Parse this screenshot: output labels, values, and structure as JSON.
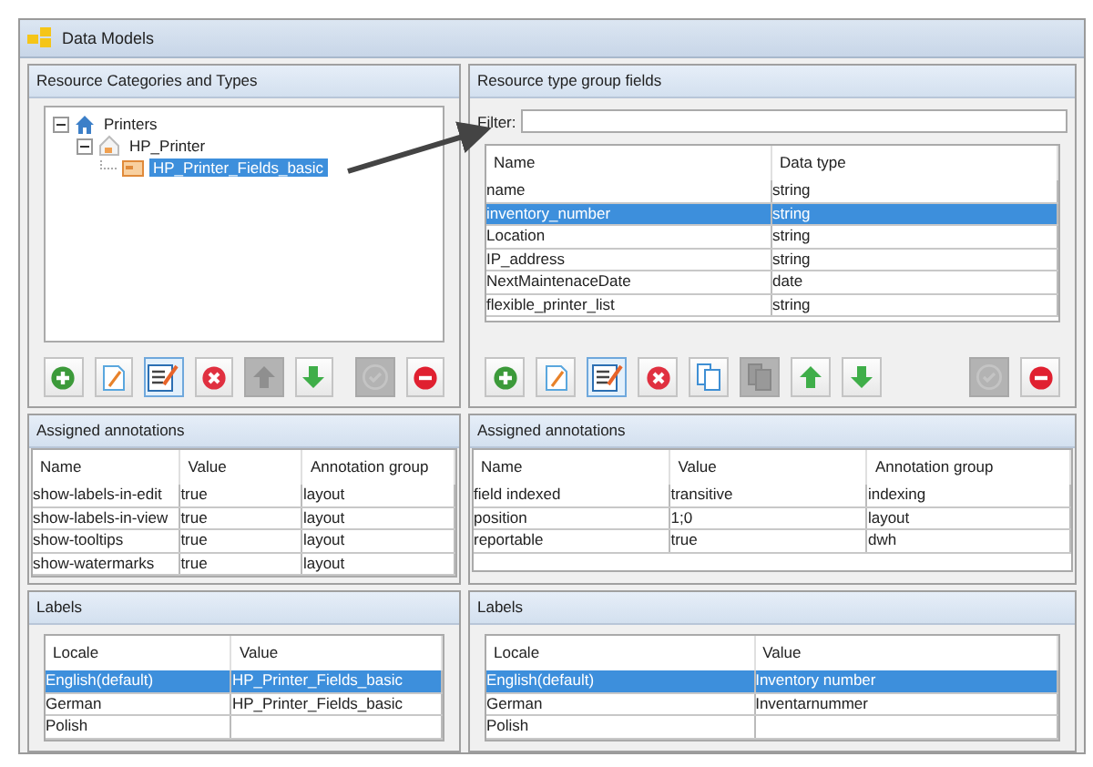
{
  "window": {
    "title": "Data Models"
  },
  "categories": {
    "title": "Resource Categories and Types",
    "tree": [
      {
        "label": "Printers",
        "kind": "root",
        "expanded": true,
        "selected": false,
        "children": [
          {
            "label": "HP_Printer",
            "kind": "type",
            "expanded": true,
            "selected": false,
            "children": [
              {
                "label": "HP_Printer_Fields_basic",
                "kind": "group",
                "selected": true
              }
            ]
          }
        ]
      }
    ],
    "buttons": [
      {
        "kind": "add",
        "disabled": false
      },
      {
        "kind": "edit",
        "disabled": false
      },
      {
        "kind": "properties",
        "disabled": false
      },
      {
        "kind": "delete",
        "disabled": false
      },
      {
        "kind": "up",
        "disabled": true
      },
      {
        "kind": "down",
        "disabled": false
      },
      {
        "kind": "spacer"
      },
      {
        "kind": "check",
        "disabled": true
      },
      {
        "kind": "remove",
        "disabled": false
      }
    ]
  },
  "fields": {
    "title": "Resource type group fields",
    "filter_label": "Filter:",
    "table": {
      "columns": [
        "Name",
        "Data type"
      ],
      "rows": [
        {
          "cells": [
            "name",
            "string"
          ],
          "selected": false
        },
        {
          "cells": [
            "inventory_number",
            "string"
          ],
          "selected": true
        },
        {
          "cells": [
            "Location",
            "string"
          ],
          "selected": false
        },
        {
          "cells": [
            "IP_address",
            "string"
          ],
          "selected": false
        },
        {
          "cells": [
            "NextMaintenaceDate",
            "date"
          ],
          "selected": false
        },
        {
          "cells": [
            "flexible_printer_list",
            "string"
          ],
          "selected": false
        }
      ]
    },
    "buttons": [
      {
        "kind": "add",
        "disabled": false
      },
      {
        "kind": "edit",
        "disabled": false
      },
      {
        "kind": "properties",
        "disabled": false
      },
      {
        "kind": "delete",
        "disabled": false
      },
      {
        "kind": "copy",
        "disabled": false
      },
      {
        "kind": "paste",
        "disabled": true
      },
      {
        "kind": "up",
        "disabled": false
      },
      {
        "kind": "down",
        "disabled": false
      },
      {
        "kind": "spacer"
      },
      {
        "kind": "check",
        "disabled": true
      },
      {
        "kind": "remove",
        "disabled": false
      }
    ]
  },
  "left_annotations": {
    "title": "Assigned annotations",
    "columns": [
      "Name",
      "Value",
      "Annotation group"
    ],
    "rows": [
      {
        "cells": [
          "show-labels-in-edit",
          "true",
          "layout"
        ],
        "selected": false
      },
      {
        "cells": [
          "show-labels-in-view",
          "true",
          "layout"
        ],
        "selected": false
      },
      {
        "cells": [
          "show-tooltips",
          "true",
          "layout"
        ],
        "selected": false
      },
      {
        "cells": [
          "show-watermarks",
          "true",
          "layout"
        ],
        "selected": false
      }
    ]
  },
  "right_annotations": {
    "title": "Assigned annotations",
    "columns": [
      "Name",
      "Value",
      "Annotation group"
    ],
    "rows": [
      {
        "cells": [
          "field indexed",
          "transitive",
          "indexing"
        ],
        "selected": false
      },
      {
        "cells": [
          "position",
          "1;0",
          "layout"
        ],
        "selected": false
      },
      {
        "cells": [
          "reportable",
          "true",
          "dwh"
        ],
        "selected": false
      }
    ]
  },
  "left_labels": {
    "title": "Labels",
    "columns": [
      "Locale",
      "Value"
    ],
    "rows": [
      {
        "cells": [
          "English(default)",
          "HP_Printer_Fields_basic"
        ],
        "selected": true
      },
      {
        "cells": [
          "German",
          "HP_Printer_Fields_basic"
        ],
        "selected": false
      },
      {
        "cells": [
          "Polish",
          ""
        ],
        "selected": false
      }
    ]
  },
  "right_labels": {
    "title": "Labels",
    "columns": [
      "Locale",
      "Value"
    ],
    "rows": [
      {
        "cells": [
          "English(default)",
          "Inventory number"
        ],
        "selected": true
      },
      {
        "cells": [
          "German",
          "Inventarnummer"
        ],
        "selected": false
      },
      {
        "cells": [
          "Polish",
          ""
        ],
        "selected": false
      }
    ]
  }
}
